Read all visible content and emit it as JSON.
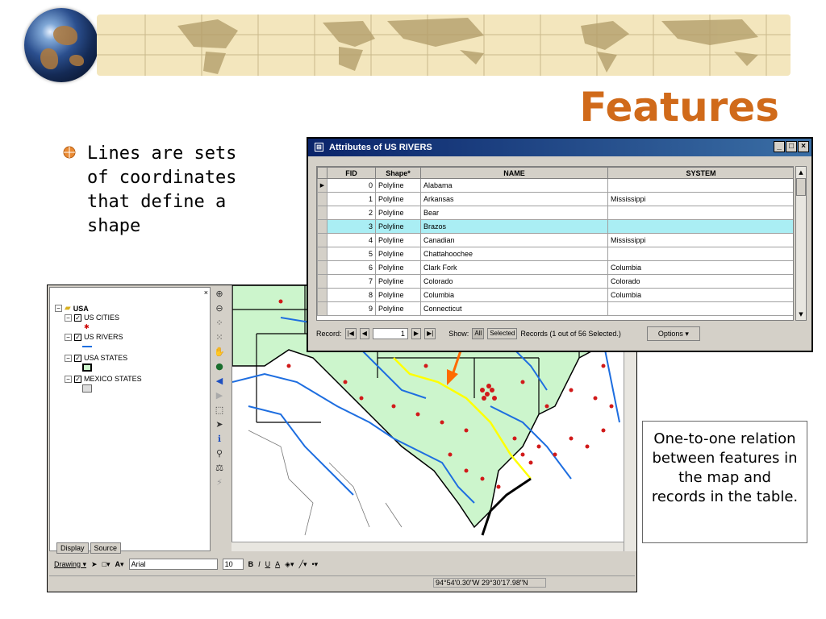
{
  "slide": {
    "title": "Features",
    "bullet": "Lines are sets of coordinates that define a shape",
    "note": "One-to-one relation between features in the map and records in the table."
  },
  "arcmap": {
    "toc": {
      "close": "×",
      "items": [
        {
          "label": "USA",
          "bold": true
        },
        {
          "label": "US CITIES"
        },
        {
          "label": "US RIVERS"
        },
        {
          "label": "USA STATES"
        },
        {
          "label": "MEXICO STATES"
        }
      ],
      "tabs": [
        "Display",
        "Source"
      ]
    },
    "drawing_toolbar": {
      "drawing": "Drawing ▾",
      "font": "Arial",
      "size": "10",
      "bold": "B",
      "italic": "I",
      "underline": "U",
      "font_color": "A"
    },
    "status": {
      "coords": "94°54'0.30\"W  29°30'17.98\"N"
    },
    "colors": {
      "map_land": "#ccf5cc",
      "river": "#1e6ee0",
      "city": "#d11a1a",
      "highlight_river": "#ffff00",
      "arrow": "#ff6a00"
    }
  },
  "attribute_table": {
    "title": "Attributes of US RIVERS",
    "window_buttons": [
      "_",
      "□",
      "×"
    ],
    "columns": [
      "FID",
      "Shape*",
      "NAME",
      "SYSTEM"
    ],
    "rows": [
      {
        "fid": "0",
        "shape": "Polyline",
        "name": "Alabama",
        "system": ""
      },
      {
        "fid": "1",
        "shape": "Polyline",
        "name": "Arkansas",
        "system": "Mississippi"
      },
      {
        "fid": "2",
        "shape": "Polyline",
        "name": "Bear",
        "system": ""
      },
      {
        "fid": "3",
        "shape": "Polyline",
        "name": "Brazos",
        "system": ""
      },
      {
        "fid": "4",
        "shape": "Polyline",
        "name": "Canadian",
        "system": "Mississippi"
      },
      {
        "fid": "5",
        "shape": "Polyline",
        "name": "Chattahoochee",
        "system": ""
      },
      {
        "fid": "6",
        "shape": "Polyline",
        "name": "Clark Fork",
        "system": "Columbia"
      },
      {
        "fid": "7",
        "shape": "Polyline",
        "name": "Colorado",
        "system": "Colorado"
      },
      {
        "fid": "8",
        "shape": "Polyline",
        "name": "Columbia",
        "system": "Columbia"
      },
      {
        "fid": "9",
        "shape": "Polyline",
        "name": "Connecticut",
        "system": ""
      }
    ],
    "selected_fid": "3",
    "navigation": {
      "record_label": "Record:",
      "record_value": "1",
      "show_label": "Show:",
      "all": "All",
      "selected": "Selected",
      "records_status": "Records  (1 out of 56 Selected.)",
      "options": "Options ▾"
    }
  }
}
